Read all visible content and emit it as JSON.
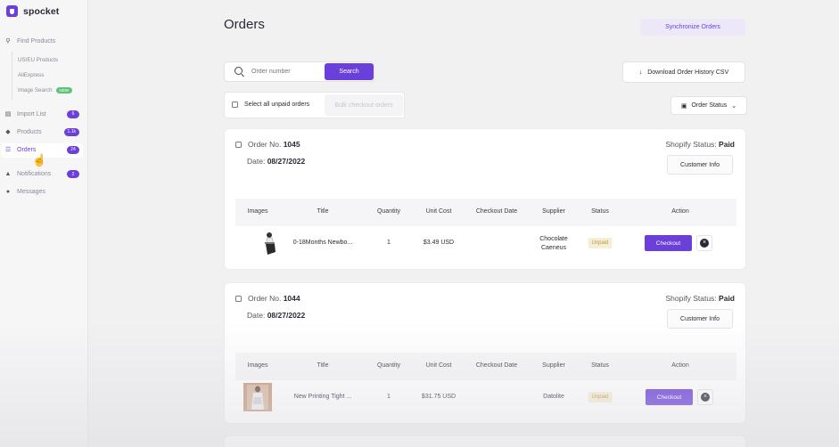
{
  "brand": {
    "name": "spocket"
  },
  "sidebar": {
    "find_products": "Find Products",
    "sub_items": [
      {
        "label": "US/EU Products"
      },
      {
        "label": "AliExpress"
      },
      {
        "label": "Image Search",
        "badge": "NEW"
      }
    ],
    "items": [
      {
        "label": "Import List",
        "badge": "6"
      },
      {
        "label": "Products",
        "badge": "1.1k"
      },
      {
        "label": "Orders",
        "badge": "24"
      },
      {
        "label": "Notifications",
        "badge": "2"
      },
      {
        "label": "Messages"
      }
    ]
  },
  "header": {
    "title": "Orders",
    "sync_label": "Synchronize Orders"
  },
  "search": {
    "placeholder": "Order number",
    "button_label": "Search"
  },
  "download_label": "Download Order History CSV",
  "filter": {
    "select_all_label": "Select all unpaid orders",
    "bulk_label": "Bulk checkout orders"
  },
  "status_dropdown": {
    "label": "Order Status"
  },
  "columns": [
    "Images",
    "Title",
    "Quantity",
    "Unit Cost",
    "Checkout Date",
    "Supplier",
    "Status",
    "Action"
  ],
  "orders": [
    {
      "order_label": "Order No.",
      "order_number": "1045",
      "date_label": "Date:",
      "date": "08/27/2022",
      "shopify_label": "Shopify Status:",
      "shopify_status": "Paid",
      "customer_info_label": "Customer Info",
      "item": {
        "title": "0-18Months Newbo...",
        "quantity": "1",
        "unit_cost": "$3.49 USD",
        "checkout_date": "",
        "supplier_line1": "Chocolate",
        "supplier_line2": "Caeneus",
        "status": "Unpaid",
        "checkout_label": "Checkout"
      }
    },
    {
      "order_label": "Order No.",
      "order_number": "1044",
      "date_label": "Date:",
      "date": "08/27/2022",
      "shopify_label": "Shopify Status:",
      "shopify_status": "Paid",
      "customer_info_label": "Customer Info",
      "item": {
        "title": "New Printing Tight ...",
        "quantity": "1",
        "unit_cost": "$31.75 USD",
        "checkout_date": "",
        "supplier_line1": "Datolite",
        "supplier_line2": "",
        "status": "Unpaid",
        "checkout_label": "Checkout"
      }
    }
  ],
  "colors": {
    "accent": "#6b3fd9",
    "new_badge": "#5cc47a",
    "unpaid_bg": "#f6efd8"
  }
}
